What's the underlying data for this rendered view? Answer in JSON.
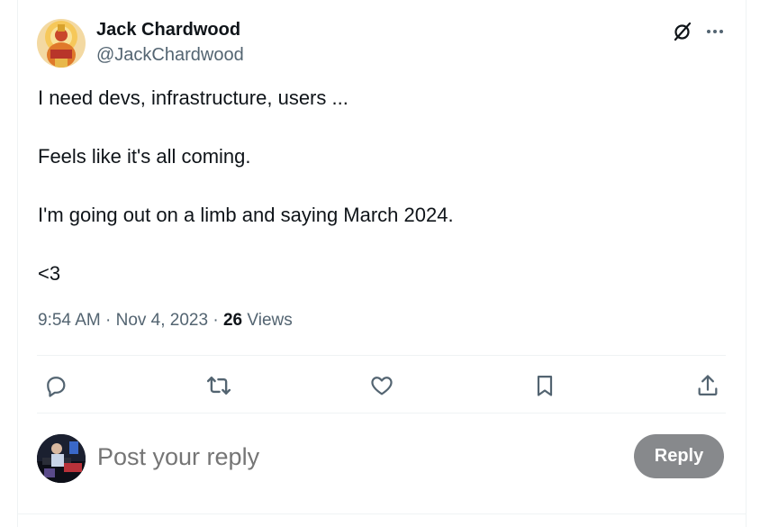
{
  "tweet": {
    "author_name": "Jack Chardwood",
    "author_handle": "@JackChardwood",
    "paragraphs": [
      "I need devs, infrastructure, users ...",
      "Feels like it's all coming.",
      "I'm going out on a limb and saying March 2024.",
      "<3"
    ],
    "time": "9:54 AM",
    "date": "Nov 4, 2023",
    "separator": "·",
    "views_count": "26",
    "views_label": "Views"
  },
  "header_icons": [
    "grok-icon",
    "more-icon"
  ],
  "actions": [
    "reply-icon",
    "retweet-icon",
    "like-icon",
    "bookmark-icon",
    "share-icon"
  ],
  "composer": {
    "placeholder": "Post your reply",
    "button_label": "Reply"
  },
  "colors": {
    "primary_text": "#0f1419",
    "secondary_text": "#536471",
    "divider": "#eff3f4",
    "reply_button_bg": "#87898c"
  }
}
